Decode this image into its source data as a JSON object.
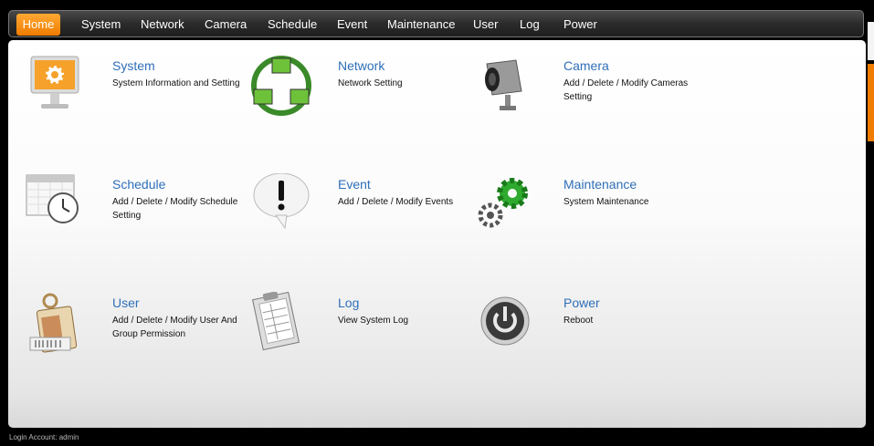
{
  "nav": {
    "items": [
      {
        "label": "Home",
        "active": true
      },
      {
        "label": "System"
      },
      {
        "label": "Network"
      },
      {
        "label": "Camera"
      },
      {
        "label": "Schedule"
      },
      {
        "label": "Event"
      },
      {
        "label": "Maintenance"
      },
      {
        "label": "User"
      },
      {
        "label": "Log"
      },
      {
        "label": "Power"
      }
    ]
  },
  "tiles": [
    {
      "title": "System",
      "desc": "System Information and Setting",
      "icon": "monitor-gear-icon"
    },
    {
      "title": "Network",
      "desc": "Network Setting",
      "icon": "network-icon"
    },
    {
      "title": "Camera",
      "desc": "Add / Delete / Modify Cameras Setting",
      "icon": "camera-icon"
    },
    {
      "title": "Schedule",
      "desc": "Add / Delete / Modify Schedule Setting",
      "icon": "calendar-clock-icon"
    },
    {
      "title": "Event",
      "desc": "Add / Delete / Modify Events",
      "icon": "exclamation-bubble-icon"
    },
    {
      "title": "Maintenance",
      "desc": "System Maintenance",
      "icon": "gears-icon"
    },
    {
      "title": "User",
      "desc": "Add / Delete / Modify User And Group Permission",
      "icon": "id-badge-icon"
    },
    {
      "title": "Log",
      "desc": "View System Log",
      "icon": "clipboard-icon"
    },
    {
      "title": "Power",
      "desc": "Reboot",
      "icon": "power-icon"
    }
  ],
  "footer": {
    "login": "Login Account: admin"
  },
  "colors": {
    "accent": "#f07c00",
    "link": "#2f6fb8"
  }
}
